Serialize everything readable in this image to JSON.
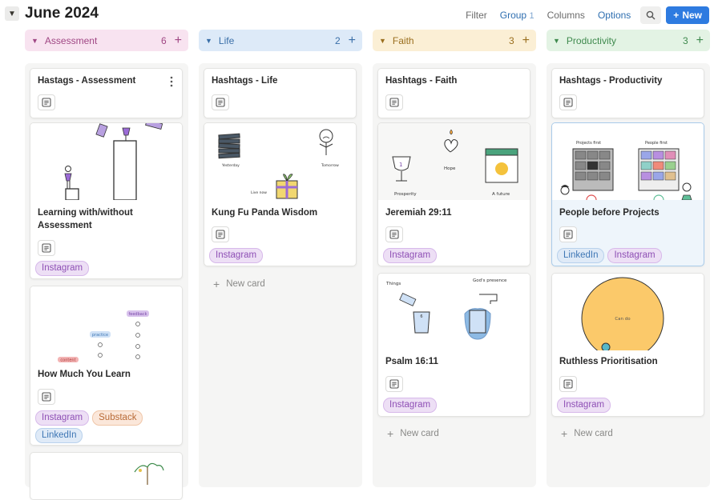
{
  "header": {
    "title": "June 2024",
    "filter_label": "Filter",
    "group_label": "Group",
    "group_count": "1",
    "columns_label": "Columns",
    "options_label": "Options",
    "new_label": "New"
  },
  "columns": [
    {
      "name": "Assessment",
      "count": "6",
      "colors": {
        "head_bg": "#f8e3f0",
        "text": "#a04784"
      },
      "cards": [
        {
          "title": "Hastags - Assessment"
        },
        {
          "title": "Learning with/without Assessment",
          "tags": [
            "Instagram"
          ]
        },
        {
          "title": "How Much You Learn",
          "tags": [
            "Instagram",
            "Substack",
            "LinkedIn"
          ],
          "img_labels": [
            "feedback",
            "practice",
            "content"
          ]
        }
      ]
    },
    {
      "name": "Life",
      "count": "2",
      "colors": {
        "head_bg": "#ddeaf8",
        "text": "#3a6fa8"
      },
      "cards": [
        {
          "title": "Hashtags - Life"
        },
        {
          "title": "Kung Fu Panda Wisdom",
          "tags": [
            "Instagram"
          ],
          "img_labels": [
            "Yesterday",
            "Tomorrow",
            "Live now"
          ]
        }
      ],
      "new_card_label": "New card"
    },
    {
      "name": "Faith",
      "count": "3",
      "colors": {
        "head_bg": "#fbefd5",
        "text": "#9a6e1e"
      },
      "cards": [
        {
          "title": "Hashtags - Faith"
        },
        {
          "title": "Jeremiah 29:11",
          "tags": [
            "Instagram"
          ],
          "img_labels": [
            "Hope",
            "Prosperity",
            "A future"
          ]
        },
        {
          "title": "Psalm 16:11",
          "tags": [
            "Instagram"
          ],
          "img_labels": [
            "Things",
            "God's presence"
          ]
        }
      ],
      "new_card_label": "New card"
    },
    {
      "name": "Productivity",
      "count": "3",
      "colors": {
        "head_bg": "#e3f3e4",
        "text": "#3f8a4e"
      },
      "cards": [
        {
          "title": "Hashtags - Productivity"
        },
        {
          "title": "People before Projects",
          "tags": [
            "LinkedIn",
            "Instagram"
          ],
          "img_labels": [
            "Projects first",
            "People first"
          ]
        },
        {
          "title": "Ruthless Prioritisation",
          "tags": [
            "Instagram"
          ],
          "img_labels": [
            "Can do"
          ]
        }
      ],
      "new_card_label": "New card"
    }
  ]
}
